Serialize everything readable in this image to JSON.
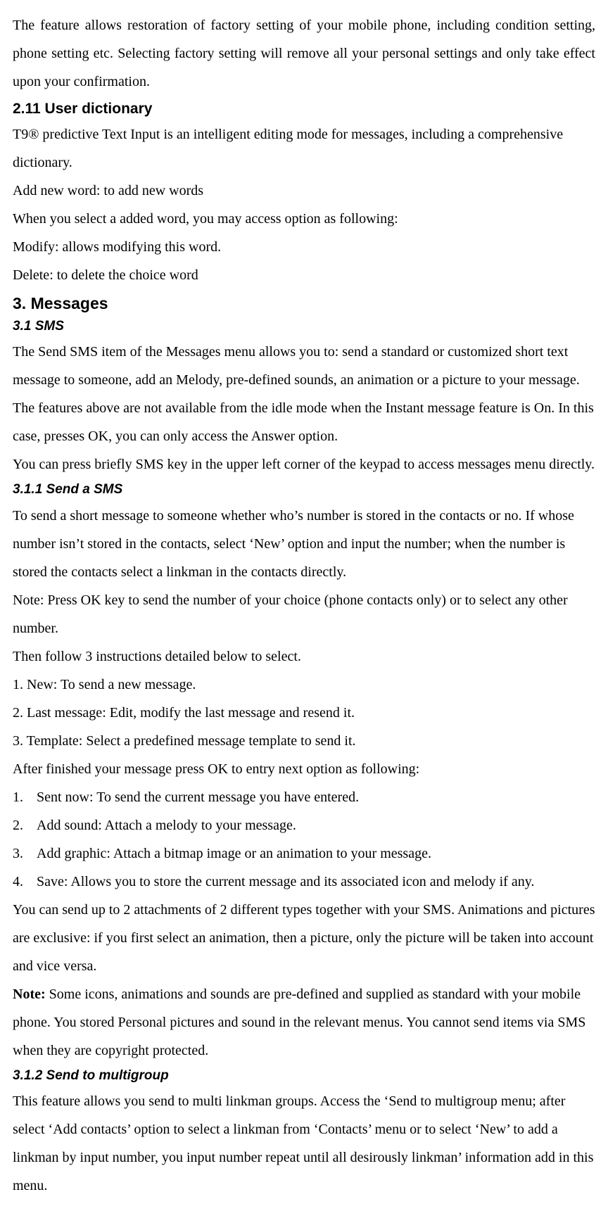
{
  "p1": "The feature allows restoration of factory setting of your mobile phone, including condition setting, phone setting etc. Selecting factory setting will remove all your personal settings and only take effect upon your confirmation.",
  "h_2_11": "2.11 User dictionary",
  "p2": "T9® predictive Text Input is an intelligent editing mode for messages, including a comprehensive dictionary.",
  "p3": "Add new word: to add new words",
  "p4": "When you select a added word, you may access option as following:",
  "p5": "Modify: allows modifying this word.",
  "p6": "Delete: to delete the choice word",
  "h_3": "3. Messages",
  "h_3_1": "3.1 SMS",
  "p7": "The Send SMS item of the Messages menu allows you to: send a standard or customized short text message to someone, add an Melody, pre-defined sounds, an animation or a picture to your message. The features above are not available from the idle mode when the Instant message feature is On. In this case, presses OK, you can only access the Answer option.",
  "p8": "You can press briefly SMS key in the upper left corner of the keypad to access messages menu directly.",
  "h_3_1_1": "3.1.1 Send a SMS",
  "p9": "To send a short message to someone whether who’s number is stored in the contacts or no. If whose number isn’t stored in the contacts, select ‘New’ option and input the number; when the number is stored the contacts select a linkman in the contacts directly.",
  "p10": "Note: Press OK key to send the number of your choice (phone contacts only) or to select any other number.",
  "p11": "Then follow 3 instructions detailed below to select.",
  "p12": "1. New: To send a new message.",
  "p13": "2. Last message: Edit, modify the last message and resend it.",
  "p14": "3. Template: Select a predefined message template to send it.",
  "p15": "After finished your message press OK to entry next option as following:",
  "ol": [
    {
      "n": "1.",
      "t": "Sent now: To send the current message you have entered."
    },
    {
      "n": "2.",
      "t": "Add sound: Attach a melody to your message."
    },
    {
      "n": "3.",
      "t": "Add graphic: Attach a bitmap image or an animation to your message."
    },
    {
      "n": "4.",
      "t": "Save: Allows you to store the current message and its associated icon and melody if any."
    }
  ],
  "p16": "You can send up to 2 attachments of 2 different types together with your SMS. Animations and pictures are exclusive: if you first select an animation, then a picture, only the picture will be taken into account and vice versa.",
  "note_label": "Note:",
  "p17": " Some icons, animations and sounds are pre-defined and supplied as standard with your mobile phone. You stored Personal pictures and sound in the relevant menus. You cannot send items via SMS when they are copyright protected.",
  "h_3_1_2": "3.1.2 Send to multigroup",
  "p18": "This feature allows you send to multi linkman groups. Access the ‘Send to multigroup menu; after select ‘Add contacts’ option to select a linkman from ‘Contacts’ menu or to select ‘New’ to add a linkman by input number, you input number repeat until all desirously linkman’ information add in this menu."
}
